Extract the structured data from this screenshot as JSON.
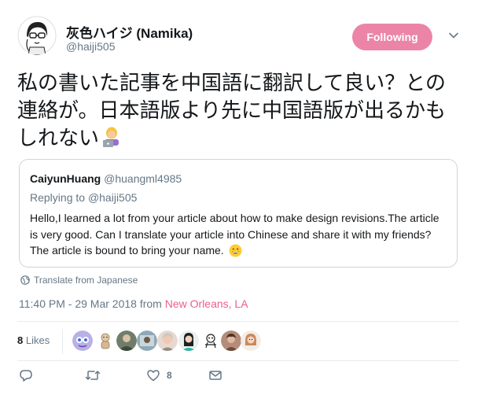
{
  "tweet": {
    "author_name": "灰色ハイジ (Namika)",
    "author_handle": "@haiji505",
    "follow_label": "Following",
    "text": "私の書いた記事を中国語に翻訳して良い？との連絡が。日本語版より先に中国語版が出るかもしれない",
    "translate_label": "Translate from Japanese",
    "timestamp": "11:40 PM - 29 Mar 2018 from ",
    "location": "New Orleans, LA"
  },
  "quoted_tweet": {
    "author_name": "CaiyunHuang",
    "author_handle": "@huangml4985",
    "replying_prefix": "Replying to ",
    "replying_handle": "@haiji505",
    "body": "Hello,I learned a lot from your article about how to make design revisions.The article is very good. Can I translate your article into Chinese and share it with my friends? The article is bound to bring your name."
  },
  "likes": {
    "count": "8",
    "label": " Likes"
  },
  "actions": {
    "like_count": "8"
  },
  "icons": [
    "avatar-sketch",
    "chevron-down-icon",
    "woman-laptop-emoji",
    "grinning-emoji",
    "globe-icon",
    "reply-icon",
    "retweet-icon",
    "heart-icon",
    "mail-icon"
  ],
  "colors": {
    "accent": "#ec84a8",
    "link": "#ec5e8f",
    "secondary": "#657786"
  }
}
